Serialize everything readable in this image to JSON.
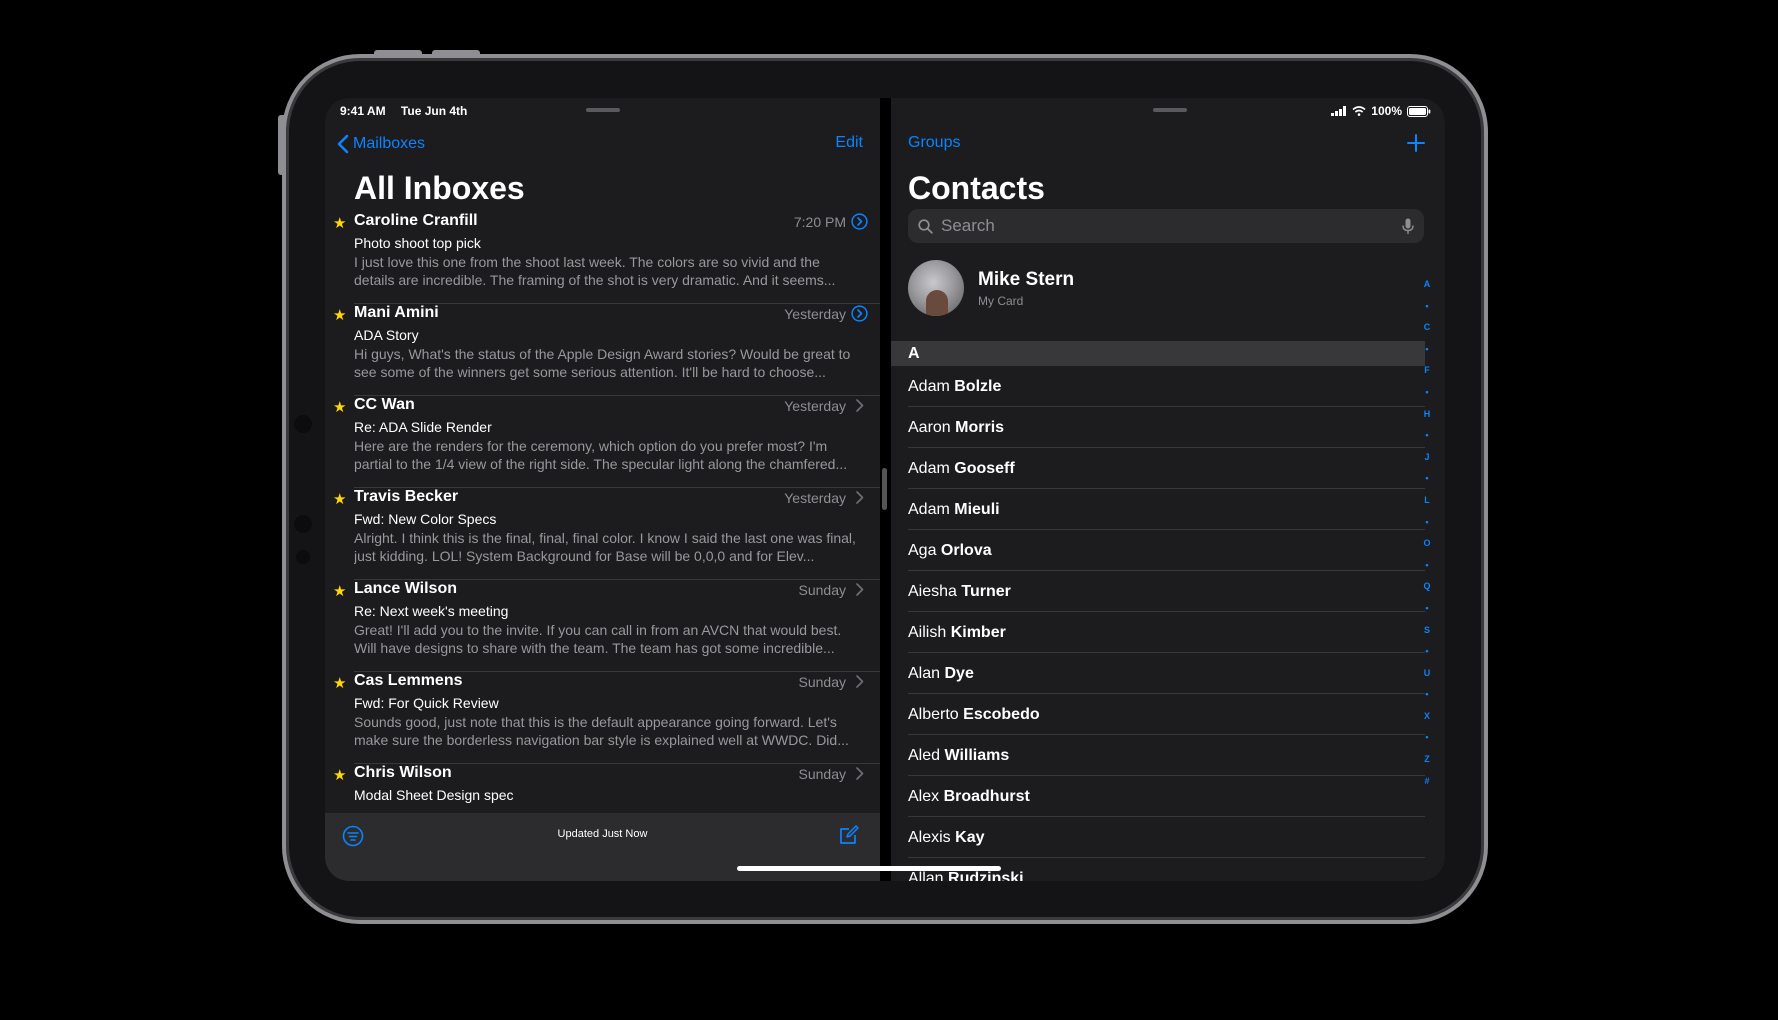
{
  "status": {
    "time": "9:41 AM",
    "date": "Tue Jun 4th",
    "battery": "100%"
  },
  "mail": {
    "back_label": "Mailboxes",
    "edit_label": "Edit",
    "title": "All Inboxes",
    "messages": [
      {
        "sender": "Caroline Cranfill",
        "time": "7:20 PM",
        "subject": "Photo shoot top pick",
        "preview": "I just love this one from the shoot last week. The colors are so vivid and the details are incredible. The framing of the shot is very dramatic. And it seems...",
        "indicator": "thread-icon"
      },
      {
        "sender": "Mani Amini",
        "time": "Yesterday",
        "subject": "ADA Story",
        "preview": "Hi guys, What's the status of the Apple Design Award stories? Would be great to see some of the winners get some serious attention. It'll be hard to choose...",
        "indicator": "thread-icon"
      },
      {
        "sender": "CC Wan",
        "time": "Yesterday",
        "subject": "Re: ADA Slide Render",
        "preview": "Here are the renders for the ceremony, which option do you prefer most? I'm partial to the 1/4 view of the right side. The specular light along the chamfered...",
        "indicator": "chevron-right-icon"
      },
      {
        "sender": "Travis Becker",
        "time": "Yesterday",
        "subject": "Fwd: New Color Specs",
        "preview": "Alright. I think this is the final, final, final color. I know I said the last one was final, just kidding. LOL! System Background for Base will be 0,0,0 and for Elev...",
        "indicator": "chevron-right-icon"
      },
      {
        "sender": "Lance Wilson",
        "time": "Sunday",
        "subject": "Re: Next week's meeting",
        "preview": "Great! I'll add you to the invite. If you can call in from an AVCN that would best. Will have designs to share with the team. The team has got some incredible...",
        "indicator": "chevron-right-icon"
      },
      {
        "sender": "Cas Lemmens",
        "time": "Sunday",
        "subject": "Fwd: For Quick Review",
        "preview": "Sounds good, just note that this is the default appearance going forward. Let's make sure the borderless navigation bar style is explained well at WWDC. Did...",
        "indicator": "chevron-right-icon"
      },
      {
        "sender": "Chris Wilson",
        "time": "Sunday",
        "subject": "Modal Sheet Design spec",
        "preview": "",
        "indicator": "chevron-right-icon"
      }
    ],
    "toolbar_status": "Updated Just Now"
  },
  "contacts": {
    "groups_label": "Groups",
    "add_label": "+",
    "title": "Contacts",
    "search_placeholder": "Search",
    "my_card": {
      "name": "Mike Stern",
      "subtitle": "My Card"
    },
    "section": "A",
    "people": [
      {
        "first": "Adam",
        "last": "Bolzle"
      },
      {
        "first": "Aaron",
        "last": "Morris"
      },
      {
        "first": "Adam",
        "last": "Gooseff"
      },
      {
        "first": "Adam",
        "last": "Mieuli"
      },
      {
        "first": "Aga",
        "last": "Orlova"
      },
      {
        "first": "Aiesha",
        "last": "Turner"
      },
      {
        "first": "Ailish",
        "last": "Kimber"
      },
      {
        "first": "Alan",
        "last": "Dye"
      },
      {
        "first": "Alberto",
        "last": "Escobedo"
      },
      {
        "first": "Aled",
        "last": "Williams"
      },
      {
        "first": "Alex",
        "last": "Broadhurst"
      },
      {
        "first": "Alexis",
        "last": "Kay"
      },
      {
        "first": "Allan",
        "last": "Rudzinski"
      }
    ],
    "index": [
      "A",
      "•",
      "C",
      "•",
      "F",
      "•",
      "H",
      "•",
      "J",
      "•",
      "L",
      "•",
      "O",
      "•",
      "Q",
      "•",
      "S",
      "•",
      "U",
      "•",
      "X",
      "•",
      "Z",
      "#"
    ]
  },
  "colors": {
    "accent": "#0a84ff",
    "star": "#ffd60a",
    "background": "#1c1c1e"
  }
}
